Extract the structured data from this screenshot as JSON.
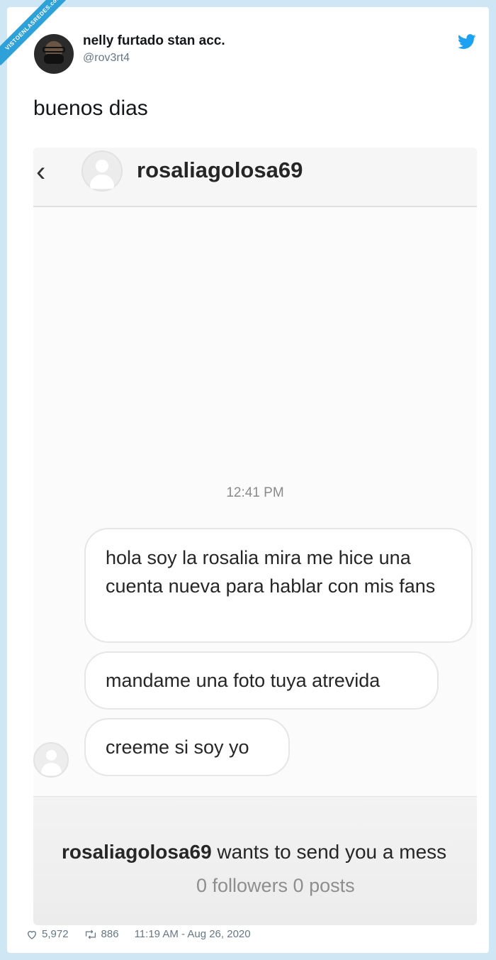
{
  "watermark": "VISTOENLASREDES.com",
  "tweet": {
    "display_name": "nelly furtado stan acc.",
    "handle": "@rov3rt4",
    "text": "buenos dias",
    "likes": "5,972",
    "retweets": "886",
    "timestamp": "11:19 AM - Aug 26, 2020",
    "brand_color": "#1da1f2"
  },
  "dm": {
    "username": "rosaliagolosa69",
    "time": "12:41 PM",
    "messages": [
      "hola soy la rosalia mira me hice una cuenta nueva para hablar con mis fans",
      "mandame una foto tuya atrevida",
      "creeme si soy yo"
    ],
    "request_user": "rosaliagolosa69",
    "request_text": " wants to send you a mess",
    "followers_text": "0 followers 0 posts"
  }
}
